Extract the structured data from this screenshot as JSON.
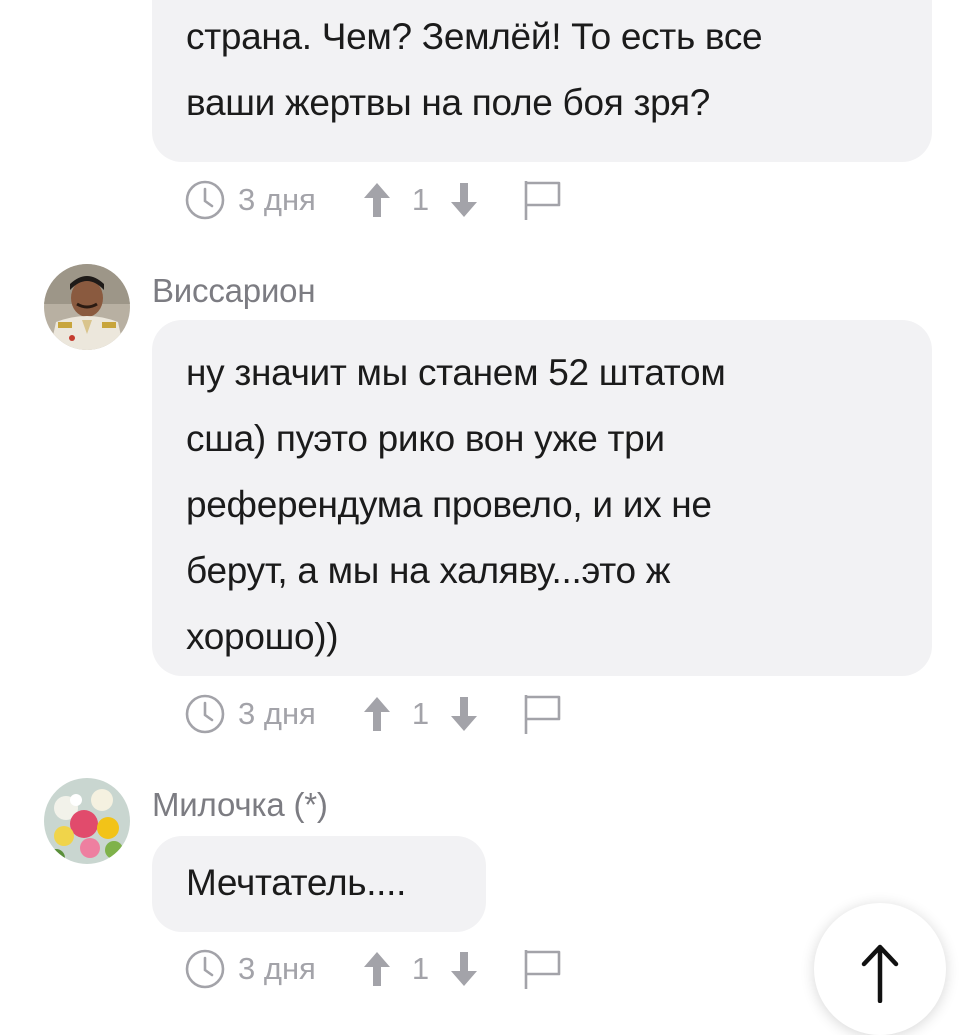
{
  "comments": [
    {
      "author": "",
      "text_lines": [
        "",
        "страна. Чем? Землёй! То есть все",
        "ваши жертвы на поле боя зря?"
      ],
      "time": "3 дня",
      "votes": "1"
    },
    {
      "author": "Виссарион",
      "text_lines": [
        "ну значит мы станем 52 штатом",
        "сша) пуэто рико вон уже три",
        "референдума провело, и их не",
        "берут, а мы на халяву...это ж",
        "хорошо))"
      ],
      "time": "3 дня",
      "votes": "1"
    },
    {
      "author": "Милочка (*)",
      "text_lines": [
        "Мечтатель...."
      ],
      "time": "3 дня",
      "votes": "1"
    }
  ],
  "icons": {
    "time": "clock-icon",
    "upvote": "arrow-up-icon",
    "downvote": "arrow-down-icon",
    "report": "flag-icon",
    "scroll_top": "arrow-up-icon"
  },
  "colors": {
    "bubble": "#f2f2f4",
    "meta": "#a3a3a9",
    "author": "#7c7c82",
    "text": "#1b1b1b"
  }
}
